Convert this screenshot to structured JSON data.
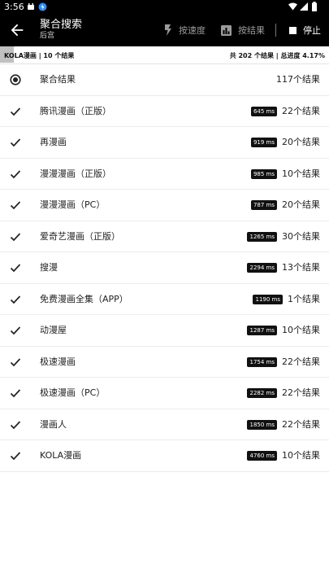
{
  "status_bar": {
    "time": "3:56"
  },
  "app_bar": {
    "title": "聚合搜索",
    "subtitle": "后宫",
    "by_speed_label": "按速度",
    "by_result_label": "按结果",
    "stop_label": "停止"
  },
  "summary": {
    "left_text": "KOLA漫画 | 10 个结果",
    "right_text": "共 202 个结果 | 总进度 4.17%",
    "progress_percent": 4.17
  },
  "aggregate": {
    "label": "聚合结果",
    "count": "117个结果",
    "icon": "radio-selected-icon"
  },
  "sources": [
    {
      "name": "腾讯漫画（正版）",
      "time": "645 ms",
      "count": "22个结果"
    },
    {
      "name": "再漫画",
      "time": "919 ms",
      "count": "20个结果"
    },
    {
      "name": "漫漫漫画（正版）",
      "time": "985 ms",
      "count": "10个结果"
    },
    {
      "name": "漫漫漫画（PC）",
      "time": "787 ms",
      "count": "20个结果"
    },
    {
      "name": "爱奇艺漫画（正版）",
      "time": "1265 ms",
      "count": "30个结果"
    },
    {
      "name": "搜漫",
      "time": "2294 ms",
      "count": "13个结果"
    },
    {
      "name": "免费漫画全集（APP）",
      "time": "1190 ms",
      "count": "1个结果"
    },
    {
      "name": "动漫屋",
      "time": "1287 ms",
      "count": "10个结果"
    },
    {
      "name": "极速漫画",
      "time": "1754 ms",
      "count": "22个结果"
    },
    {
      "name": "极速漫画（PC）",
      "time": "2282 ms",
      "count": "22个结果"
    },
    {
      "name": "漫画人",
      "time": "1850 ms",
      "count": "22个结果"
    },
    {
      "name": "KOLA漫画",
      "time": "4760 ms",
      "count": "10个结果"
    }
  ],
  "colors": {
    "app_bar": "#000000",
    "badge": "#111111",
    "progress": "#8c8c8c"
  }
}
